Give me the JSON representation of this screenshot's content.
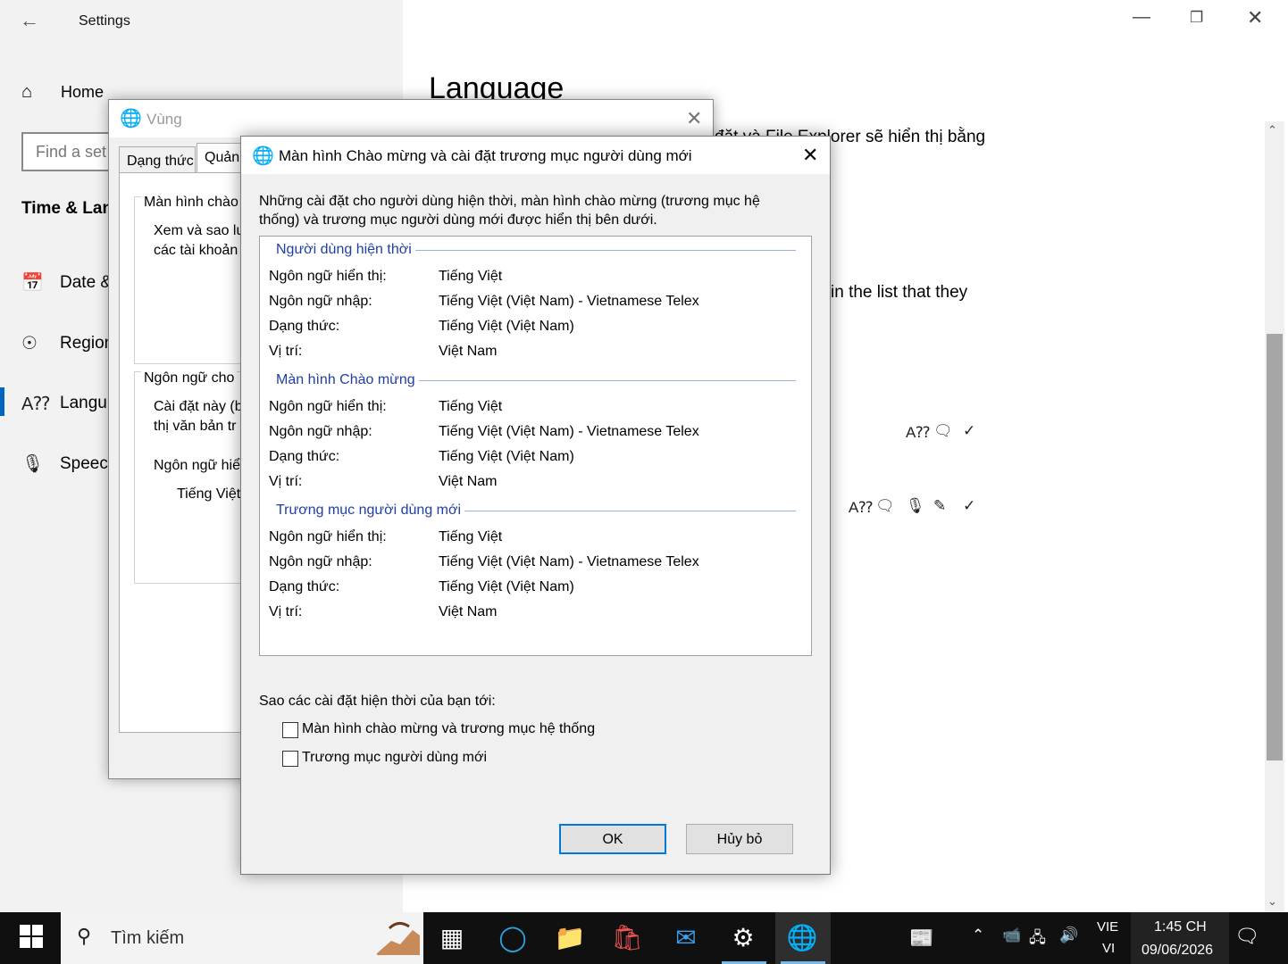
{
  "settings": {
    "window_title": "Settings",
    "home_label": "Home",
    "find_placeholder": "Find a set",
    "section_title": "Time & Lan",
    "nav_items": [
      "Date &",
      "Region",
      "Langu",
      "Speecl"
    ],
    "heading": "Language",
    "content_text_1": "đặt và File Explorer sẽ hiển thị bằng",
    "content_text_2": "in the list that they"
  },
  "region_dialog": {
    "title": "Vùng",
    "tabs": [
      "Dạng thức",
      "Quản t"
    ],
    "group1_title": "Màn hình chào",
    "group1_lines": [
      "Xem và sao lư",
      "các tài khoản"
    ],
    "group2_title": "Ngôn ngữ cho",
    "group2_lines": [
      "Cài đặt này (b",
      "thị văn bản tr"
    ],
    "group2_sub_label": "Ngôn ngữ hiể",
    "group2_sub_value": "Tiếng Việt"
  },
  "welcome_dialog": {
    "title": "Màn hình Chào mừng và cài đặt trương mục người dùng mới",
    "intro": "Những cài đặt cho người dùng hiện thời, màn hình chào mừng (trương mục hệ thống) và trương mục người dùng mới được hiển thị bên dưới.",
    "sections": [
      {
        "title": "Người dùng hiện thời",
        "rows": [
          {
            "label": "Ngôn ngữ hiển thị:",
            "value": "Tiếng Việt"
          },
          {
            "label": "Ngôn ngữ nhập:",
            "value": "Tiếng Việt (Việt Nam) - Vietnamese Telex"
          },
          {
            "label": "Dạng thức:",
            "value": "Tiếng Việt (Việt Nam)"
          },
          {
            "label": "Vị trí:",
            "value": "Việt Nam"
          }
        ]
      },
      {
        "title": "Màn hình Chào mừng",
        "rows": [
          {
            "label": "Ngôn ngữ hiển thị:",
            "value": "Tiếng Việt"
          },
          {
            "label": "Ngôn ngữ nhập:",
            "value": "Tiếng Việt (Việt Nam) - Vietnamese Telex"
          },
          {
            "label": "Dạng thức:",
            "value": "Tiếng Việt (Việt Nam)"
          },
          {
            "label": "Vị trí:",
            "value": "Việt Nam"
          }
        ]
      },
      {
        "title": "Trương mục người dùng mới",
        "rows": [
          {
            "label": "Ngôn ngữ hiển thị:",
            "value": "Tiếng Việt"
          },
          {
            "label": "Ngôn ngữ nhập:",
            "value": "Tiếng Việt (Việt Nam) - Vietnamese Telex"
          },
          {
            "label": "Dạng thức:",
            "value": "Tiếng Việt (Việt Nam)"
          },
          {
            "label": "Vị trí:",
            "value": "Việt Nam"
          }
        ]
      }
    ],
    "copy_label": "Sao các cài đặt hiện thời của bạn tới:",
    "checkbox_1": "Màn hình chào mừng và trương mục hệ thống",
    "checkbox_2": "Trương mục người dùng mới",
    "checkbox_1_checked": false,
    "checkbox_2_checked": false,
    "ok_label": "OK",
    "cancel_label": "Hủy bỏ"
  },
  "taskbar": {
    "search_text": "Tìm kiếm",
    "lang_line_1": "VIE",
    "lang_line_2": "VI",
    "time": "1:45 CH",
    "date": "09/06/2026"
  },
  "colors": {
    "accent": "#0078d7",
    "section_title": "#1f3fa3",
    "taskbar": "#101010"
  }
}
